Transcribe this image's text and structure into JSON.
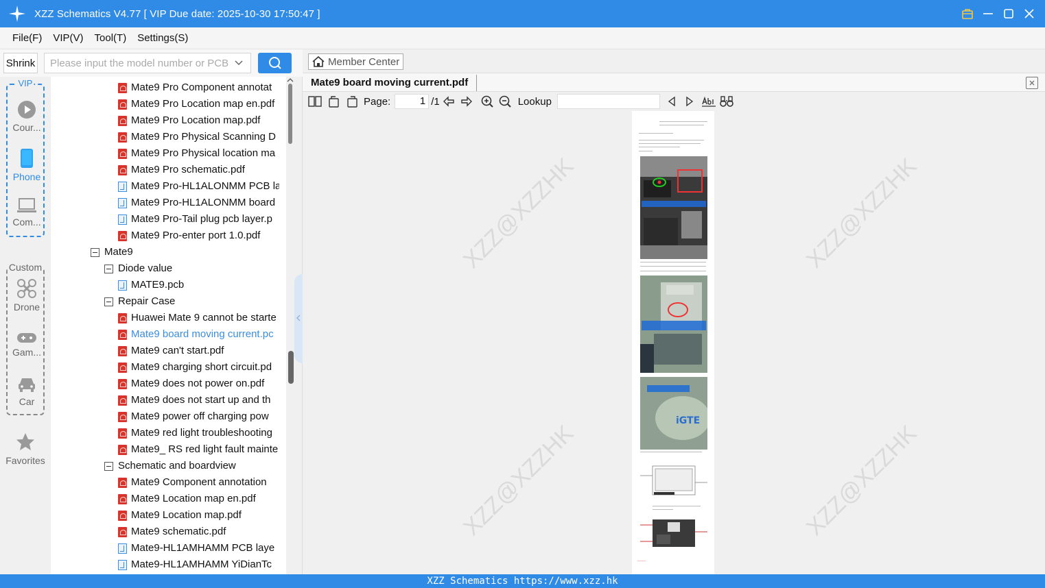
{
  "window": {
    "title": "XZZ Schematics V4.77 [ VIP Due date: 2025-10-30 17:50:47 ]",
    "accent": "#2f8be6"
  },
  "menu": [
    "File(F)",
    "VIP(V)",
    "Tool(T)",
    "Settings(S)"
  ],
  "toolbar": {
    "shrink_label": "Shrink",
    "search_placeholder": "Please input the model number or PCB"
  },
  "categories": {
    "vip_label": "VIP",
    "vip_items": [
      "Cour...",
      "Phone",
      "Com..."
    ],
    "custom_label": "Custom",
    "custom_items": [
      "Drone",
      "Gam...",
      "Car"
    ],
    "favorites": "Favorites"
  },
  "tree": [
    {
      "type": "pdf",
      "indent": 2,
      "label": "Mate9 Pro Component annotat"
    },
    {
      "type": "pdf",
      "indent": 2,
      "label": "Mate9 Pro Location map en.pdf"
    },
    {
      "type": "pdf",
      "indent": 2,
      "label": "Mate9 Pro Location map.pdf"
    },
    {
      "type": "pdf",
      "indent": 2,
      "label": "Mate9 Pro Physical Scanning D"
    },
    {
      "type": "pdf",
      "indent": 2,
      "label": "Mate9 Pro Physical location ma"
    },
    {
      "type": "pdf",
      "indent": 2,
      "label": "Mate9 Pro schematic.pdf"
    },
    {
      "type": "pcb",
      "indent": 2,
      "label": "Mate9 Pro-HL1ALONMM PCB la"
    },
    {
      "type": "pcb",
      "indent": 2,
      "label": "Mate9 Pro-HL1ALONMM board"
    },
    {
      "type": "pcb",
      "indent": 2,
      "label": "Mate9 Pro-Tail plug pcb layer.p"
    },
    {
      "type": "pdf",
      "indent": 2,
      "label": "Mate9 Pro-enter port 1.0.pdf"
    },
    {
      "type": "folder",
      "indent": 0,
      "label": "Mate9"
    },
    {
      "type": "folder",
      "indent": 1,
      "label": "Diode value"
    },
    {
      "type": "pcb",
      "indent": 2,
      "label": "MATE9.pcb"
    },
    {
      "type": "folder",
      "indent": 1,
      "label": "Repair Case"
    },
    {
      "type": "pdf",
      "indent": 2,
      "label": "Huawei Mate 9 cannot be starte"
    },
    {
      "type": "pdf",
      "indent": 2,
      "label": "Mate9 board moving current.pc",
      "selected": true
    },
    {
      "type": "pdf",
      "indent": 2,
      "label": "Mate9 can't start.pdf"
    },
    {
      "type": "pdf",
      "indent": 2,
      "label": "Mate9 charging short circuit.pd"
    },
    {
      "type": "pdf",
      "indent": 2,
      "label": "Mate9 does not power on.pdf"
    },
    {
      "type": "pdf",
      "indent": 2,
      "label": "Mate9 does not start up and th"
    },
    {
      "type": "pdf",
      "indent": 2,
      "label": "Mate9 power off charging pow"
    },
    {
      "type": "pdf",
      "indent": 2,
      "label": "Mate9 red light troubleshooting"
    },
    {
      "type": "pdf",
      "indent": 2,
      "label": "Mate9_ RS red light fault mainte"
    },
    {
      "type": "folder",
      "indent": 1,
      "label": "Schematic and boardview"
    },
    {
      "type": "pdf",
      "indent": 2,
      "label": "Mate9 Component annotation"
    },
    {
      "type": "pdf",
      "indent": 2,
      "label": "Mate9 Location map en.pdf"
    },
    {
      "type": "pdf",
      "indent": 2,
      "label": "Mate9 Location map.pdf"
    },
    {
      "type": "pdf",
      "indent": 2,
      "label": "Mate9 schematic.pdf"
    },
    {
      "type": "pcb",
      "indent": 2,
      "label": "Mate9-HL1AMHAMM PCB laye"
    },
    {
      "type": "pcb",
      "indent": 2,
      "label": "Mate9-HL1AMHAMM YiDianTc"
    }
  ],
  "right": {
    "member_center": "Member Center",
    "doc_tab": "Mate9 board moving current.pdf",
    "page_label": "Page:",
    "page_current": "1",
    "page_total": "/1",
    "lookup_label": "Lookup",
    "watermark": "XZZ@XZZHK"
  },
  "footer": "XZZ Schematics https://www.xzz.hk"
}
